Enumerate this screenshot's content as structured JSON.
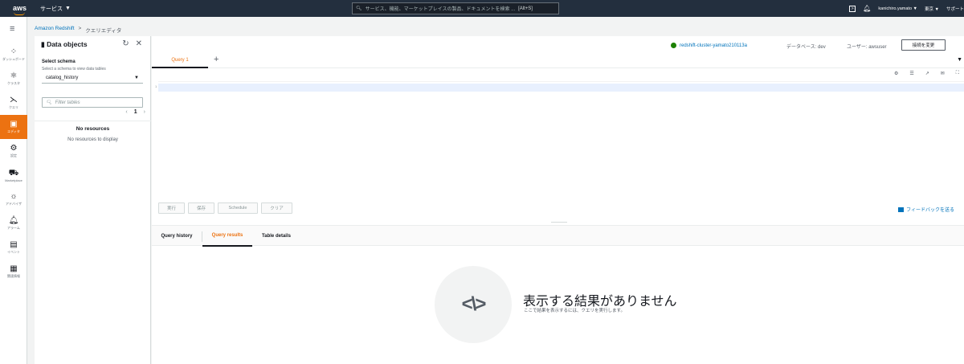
{
  "topnav": {
    "logo": "aws",
    "services": "サービス",
    "search_placeholder": "サービス、機能、マーケットプレイスの製品、ドキュメントを検索 ...",
    "search_shortcut": "[Alt+S]",
    "user": "kanichiro.yamato",
    "region": "東京",
    "support": "サポート"
  },
  "rail": {
    "items": [
      {
        "label": "ダッシュボード",
        "icon": "dashboard-icon"
      },
      {
        "label": "クラスタ",
        "icon": "cluster-icon"
      },
      {
        "label": "クエリ",
        "icon": "query-icon"
      },
      {
        "label": "エディタ",
        "icon": "editor-icon"
      },
      {
        "label": "設定",
        "icon": "settings-icon"
      },
      {
        "label": "Marketplace",
        "icon": "marketplace-icon"
      },
      {
        "label": "アドバイザ",
        "icon": "advisor-icon"
      },
      {
        "label": "アラーム",
        "icon": "alarm-icon"
      },
      {
        "label": "イベント",
        "icon": "events-icon"
      },
      {
        "label": "関連情報",
        "icon": "info-icon"
      }
    ]
  },
  "breadcrumb": {
    "parent": "Amazon Redshift",
    "current": "クエリエディタ"
  },
  "data_objects": {
    "title": "Data objects",
    "select_label": "Select schema",
    "select_desc": "Select a schema to view data tables",
    "schema_value": "catalog_history",
    "filter_placeholder": "Filter tables",
    "page": "1",
    "no_resources_title": "No resources",
    "no_resources_text": "No resources to display"
  },
  "editor": {
    "cluster": "redshift-cluster-yamato210113a",
    "database": "データベース: dev",
    "user": "ユーザー: awsuser",
    "change_connection": "接続を変更",
    "tab": "Query 1",
    "line_number": "1",
    "actions": {
      "run": "実行",
      "save": "保存",
      "schedule": "Schedule",
      "clear": "クリア"
    },
    "feedback": "フィードバックを送る"
  },
  "results": {
    "tabs": [
      "Query history",
      "Query results",
      "Table details"
    ],
    "active_tab": "Query results",
    "empty_title": "表示する結果がありません",
    "empty_text": "ここで結果を表示するには、クエリを実行します。"
  }
}
